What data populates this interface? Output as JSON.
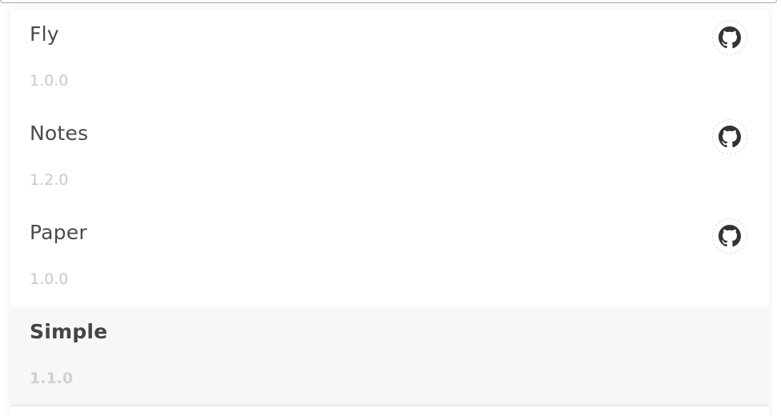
{
  "themes": [
    {
      "name": "Fly",
      "version": "1.0.0",
      "has_github": true,
      "active": false
    },
    {
      "name": "Notes",
      "version": "1.2.0",
      "has_github": true,
      "active": false
    },
    {
      "name": "Paper",
      "version": "1.0.0",
      "has_github": true,
      "active": false
    },
    {
      "name": "Simple",
      "version": "1.1.0",
      "has_github": false,
      "active": true
    }
  ],
  "icons": {
    "github": "github-icon"
  },
  "colors": {
    "text": "#4a4a4a",
    "version_text": "#c8c8c8",
    "active_bg": "#f7f7f7"
  }
}
